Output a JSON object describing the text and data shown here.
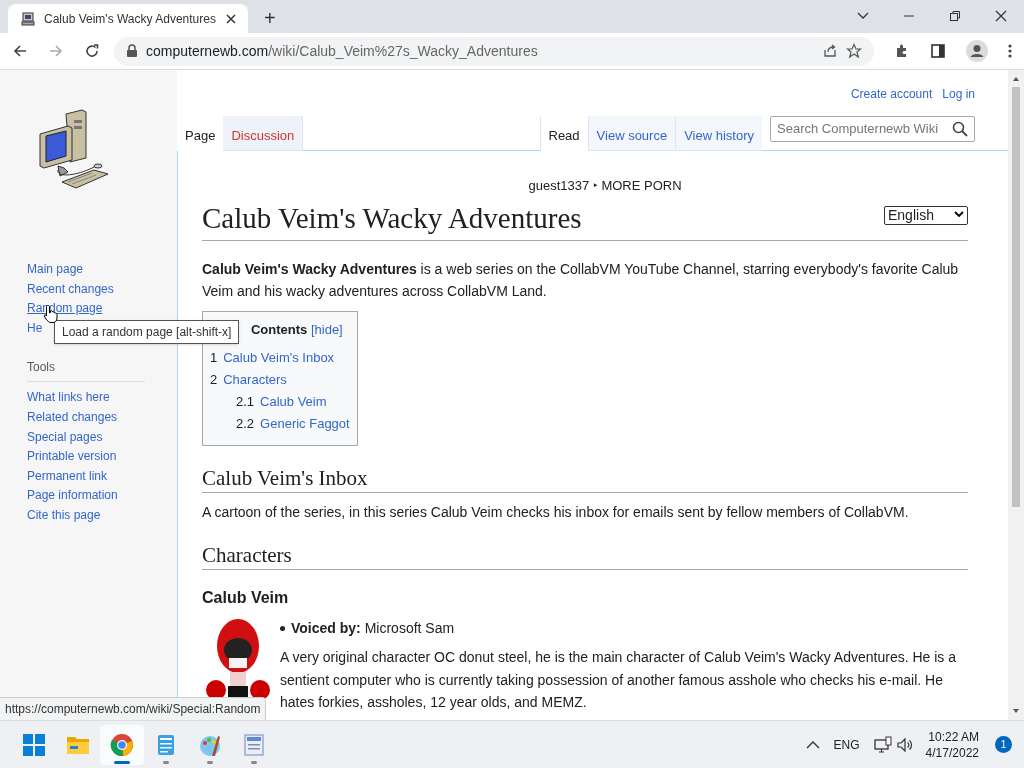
{
  "browser": {
    "tab_title": "Calub Veim's Wacky Adventures",
    "new_tab": "+",
    "url_host": "computernewb.com",
    "url_path": "/wiki/Calub_Veim%27s_Wacky_Adventures"
  },
  "personal_links": [
    "Create account",
    "Log in"
  ],
  "namespace_tabs": [
    {
      "label": "Page",
      "selected": true,
      "redlink": false
    },
    {
      "label": "Discussion",
      "selected": false,
      "redlink": true
    }
  ],
  "view_tabs": [
    {
      "label": "Read",
      "selected": true
    },
    {
      "label": "View source",
      "selected": false
    },
    {
      "label": "View history",
      "selected": false
    }
  ],
  "search": {
    "placeholder": "Search Computernewb Wiki"
  },
  "sidebar": {
    "navigation": [
      {
        "label": "Main page",
        "hovered": false
      },
      {
        "label": "Recent changes",
        "hovered": false
      },
      {
        "label": "Random page",
        "hovered": true
      },
      {
        "label": "He",
        "hovered": false
      }
    ],
    "tools_heading": "Tools",
    "tools": [
      {
        "label": "What links here",
        "hovered": false
      },
      {
        "label": "Related changes",
        "hovered": false
      },
      {
        "label": "Special pages",
        "hovered": false
      },
      {
        "label": "Printable version",
        "hovered": false
      },
      {
        "label": "Permanent link",
        "hovered": false
      },
      {
        "label": "Page information",
        "hovered": false
      },
      {
        "label": "Cite this page",
        "hovered": false
      }
    ]
  },
  "tooltip": "Load a random page [alt-shift-x]",
  "subtitle": "guest1337 ‣ MORE PORN",
  "language": "English",
  "title": "Calub Veim's Wacky Adventures",
  "intro": "**Calub Veim's Wacky Adventures** is a web series on the CollabVM YouTube Channel, starring everybody's favorite Calub Veim and his wacky adventures across CollabVM Land.",
  "toc": {
    "title": "Contents",
    "toggle": "[hide]",
    "items": [
      {
        "number": "1",
        "label": "Calub Veim's Inbox"
      },
      {
        "number": "2",
        "label": "Characters",
        "children": [
          {
            "number": "2.1",
            "label": "Calub Veim"
          },
          {
            "number": "2.2",
            "label": "Generic Faggot"
          }
        ]
      }
    ]
  },
  "sections": [
    {
      "heading": "Calub Veim's Inbox",
      "text": "A cartoon of the series, in this series Calub Veim checks his inbox for emails sent by fellow members of CollabVM."
    },
    {
      "heading": "Characters",
      "subsection": {
        "heading": "Calub Veim",
        "bullet": "**Voiced by:** Microsoft Sam",
        "text": "A very original character OC donut steel, he is the main character of Calub Veim's Wacky Adventures. He is a sentient computer who is currently taking possession of another famous asshole who checks his e-mail. He hates forkies, assholes, 12 year olds, and MEMZ."
      }
    }
  ],
  "status_url": "https://computernewb.com/wiki/Special:Random",
  "taskbar": {
    "apps": [
      {
        "kind": "start",
        "active": false,
        "running": false
      },
      {
        "kind": "folder",
        "active": false,
        "running": false
      },
      {
        "kind": "browser",
        "active": true,
        "running": true
      },
      {
        "kind": "notepad",
        "active": false,
        "running": true
      },
      {
        "kind": "paint",
        "active": false,
        "running": true
      },
      {
        "kind": "document",
        "active": false,
        "running": true
      }
    ],
    "language": "ENG",
    "time": "10:22 AM",
    "date": "4/17/2022",
    "notifications": "1"
  }
}
